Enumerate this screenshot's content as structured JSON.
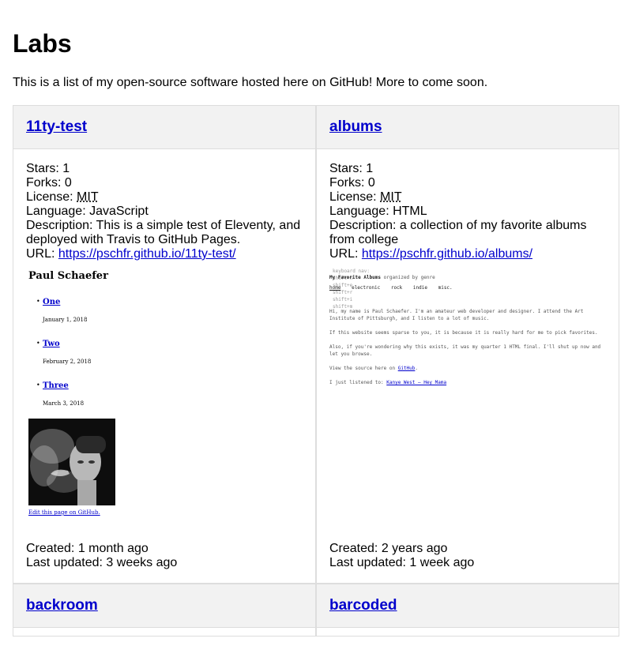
{
  "page": {
    "title": "Labs",
    "intro": "This is a list of my open-source software hosted here on GitHub! More to come soon."
  },
  "labels": {
    "stars": "Stars: ",
    "forks": "Forks: ",
    "license": "License: ",
    "language": "Language: ",
    "description": "Description: ",
    "url": "URL: ",
    "created": "Created: ",
    "updated": "Last updated: "
  },
  "repos": [
    {
      "name": "11ty-test",
      "stars": "1",
      "forks": "0",
      "license": "MIT",
      "language": "JavaScript",
      "description": "This is a simple test of Eleventy, and deployed with Travis to GitHub Pages.",
      "url": "https://pschfr.github.io/11ty-test/",
      "created": "1 month ago",
      "updated": "3 weeks ago",
      "preview": {
        "site_title": "Paul Schaefer",
        "posts": [
          {
            "title": "One",
            "date": "January 1, 2018"
          },
          {
            "title": "Two",
            "date": "February 2, 2018"
          },
          {
            "title": "Three",
            "date": "March 3, 2018"
          }
        ],
        "edit_link": "Edit this page on GitHub."
      }
    },
    {
      "name": "albums",
      "stars": "1",
      "forks": "0",
      "license": "MIT",
      "language": "HTML",
      "description": "a collection of my favorite albums from college",
      "url": "https://pschfr.github.io/albums/",
      "created": "2 years ago",
      "updated": "1 week ago",
      "preview": {
        "keyboard_nav": [
          "keyboard nav:",
          "shift+h",
          "shift+e",
          "shift+r",
          "shift+i",
          "shift+m"
        ],
        "heading": "My Favorite Albums",
        "subheading": "organized by genre",
        "nav": [
          "home",
          "electronic",
          "rock",
          "indie",
          "misc."
        ],
        "para1": "Hi, my name is Paul Schaefer. I'm an amateur web developer and designer. I attend the Art Institute of Pittsburgh, and I listen to a lot of music.",
        "para2": "If this website seems sparse to you, it is because it is really hard for me to pick favorites.",
        "para3": "Also, if you're wondering why this exists, it was my quarter 1 HTML final. I'll shut up now and let you browse.",
        "para4_prefix": "View the source here on ",
        "para4_link": "GitHub",
        "para5_prefix": "I just listened to: ",
        "para5_link": "Kanye West — Hey Mama"
      }
    },
    {
      "name": "backroom"
    },
    {
      "name": "barcoded"
    }
  ]
}
